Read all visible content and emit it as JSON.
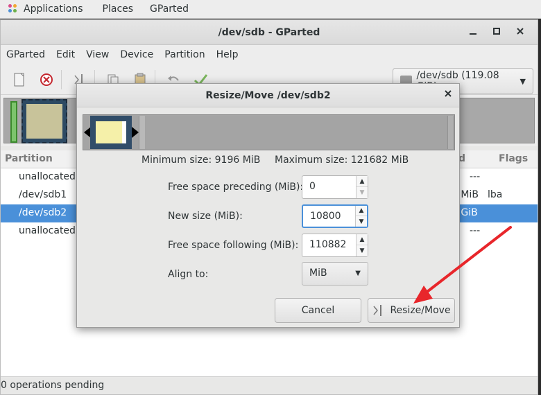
{
  "top_panel": {
    "applications": "Applications",
    "places": "Places",
    "app_name": "GParted"
  },
  "window": {
    "title": "/dev/sdb - GParted",
    "controls": {
      "minimize": "_",
      "maximize": "□",
      "close": "×"
    }
  },
  "menu": [
    "GParted",
    "Edit",
    "View",
    "Device",
    "Partition",
    "Help"
  ],
  "toolbar": {
    "device_select": "/dev/sdb  (119.08 GiB)"
  },
  "table": {
    "headers": {
      "partition": "Partition",
      "used": "d",
      "flags": "Flags"
    },
    "rows": [
      {
        "partition": "unallocated",
        "used": "",
        "flags": "---"
      },
      {
        "partition": "/dev/sdb1",
        "used": "3 MiB",
        "flags": "lba"
      },
      {
        "partition": "/dev/sdb2",
        "used": "2 GiB",
        "flags": ""
      },
      {
        "partition": "unallocated",
        "used": "",
        "flags": "---"
      }
    ]
  },
  "status": "0 operations pending",
  "dialog": {
    "title": "Resize/Move /dev/sdb2",
    "close": "×",
    "min_size": "Minimum size: 9196 MiB",
    "max_size": "Maximum size: 121682 MiB",
    "fields": {
      "preceding_label": "Free space preceding (MiB):",
      "preceding_value": "0",
      "new_size_label": "New size (MiB):",
      "new_size_value": "10800",
      "following_label": "Free space following (MiB):",
      "following_value": "110882",
      "align_label": "Align to:",
      "align_value": "MiB"
    },
    "cancel": "Cancel",
    "resize_move": "Resize/Move"
  },
  "colors": {
    "selection": "#4a90d9",
    "annotation_arrow": "#e8262b",
    "partition_fill": "#f5f0a9",
    "partition_border": "#314d69"
  }
}
